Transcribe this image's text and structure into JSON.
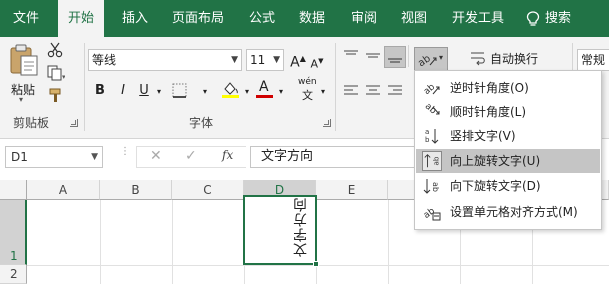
{
  "colors": {
    "brand": "#217346",
    "ribbon_bg": "#f3f3f3",
    "font_color_bar": "#d00000",
    "fill_color_bar": "#ffff00"
  },
  "tabs": [
    {
      "label": "文件"
    },
    {
      "label": "开始"
    },
    {
      "label": "插入"
    },
    {
      "label": "页面布局"
    },
    {
      "label": "公式"
    },
    {
      "label": "数据"
    },
    {
      "label": "审阅"
    },
    {
      "label": "视图"
    },
    {
      "label": "开发工具"
    }
  ],
  "search": {
    "label": "搜索",
    "icon": "lightbulb-icon"
  },
  "clipboard": {
    "paste_label": "粘贴",
    "group_label": "剪贴板"
  },
  "font": {
    "group_label": "字体",
    "name": "等线",
    "size": "11",
    "bold": "B",
    "italic": "I",
    "underline": "U",
    "grow": "A",
    "shrink": "A",
    "color_glyph": "A",
    "phonetic": "wén"
  },
  "alignment": {
    "wrap_text_label": "自动换行"
  },
  "number": {
    "format": "常规"
  },
  "formula_bar": {
    "name_box": "D1",
    "fx": "fx",
    "content": "文字方向"
  },
  "sheet": {
    "columns": [
      "A",
      "B",
      "C",
      "D",
      "E"
    ],
    "rows": [
      "1",
      "2"
    ],
    "selected_column": "D",
    "cell_d1": "文字方向"
  },
  "orientation_menu": {
    "items": [
      {
        "label": "逆时针角度(O)",
        "icon": "angle-counterclockwise-icon"
      },
      {
        "label": "顺时针角度(L)",
        "icon": "angle-clockwise-icon"
      },
      {
        "label": "竖排文字(V)",
        "icon": "vertical-text-icon"
      },
      {
        "label": "向上旋转文字(U)",
        "icon": "rotate-text-up-icon"
      },
      {
        "label": "向下旋转文字(D)",
        "icon": "rotate-text-down-icon"
      },
      {
        "label": "设置单元格对齐方式(M)",
        "icon": "format-cell-alignment-icon"
      }
    ],
    "highlighted_index": 3
  }
}
